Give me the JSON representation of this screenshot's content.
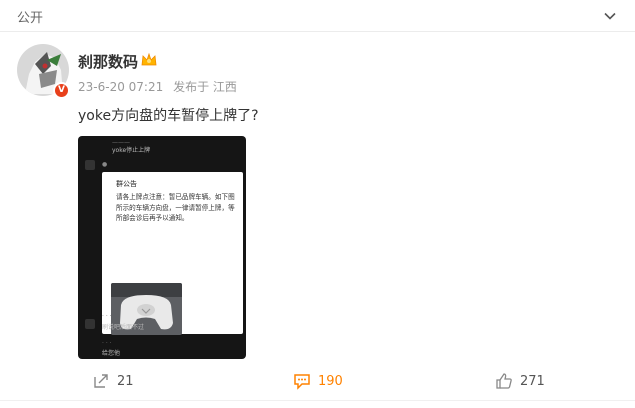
{
  "topbar": {
    "visibility": "公开"
  },
  "post": {
    "username": "刹那数码",
    "time": "23-6-20 07:21",
    "source": "发布于 江西",
    "text": "yoke方向盘的车暂停上牌了?",
    "image": {
      "top_msg": "yoke停止上牌",
      "card_title": "群公告",
      "card_body": "请各上牌点注意：暂已品牌车辆。如下图所示的车辆方向盘，一律请暂停上牌，等所部会诊后再予以通知。",
      "reply": "刷说吧后面不过",
      "reply2": "给您他"
    }
  },
  "actions": {
    "share": "21",
    "comment": "190",
    "like": "271"
  },
  "colors": {
    "accent": "#ff8200",
    "badge": "#e8401b"
  }
}
